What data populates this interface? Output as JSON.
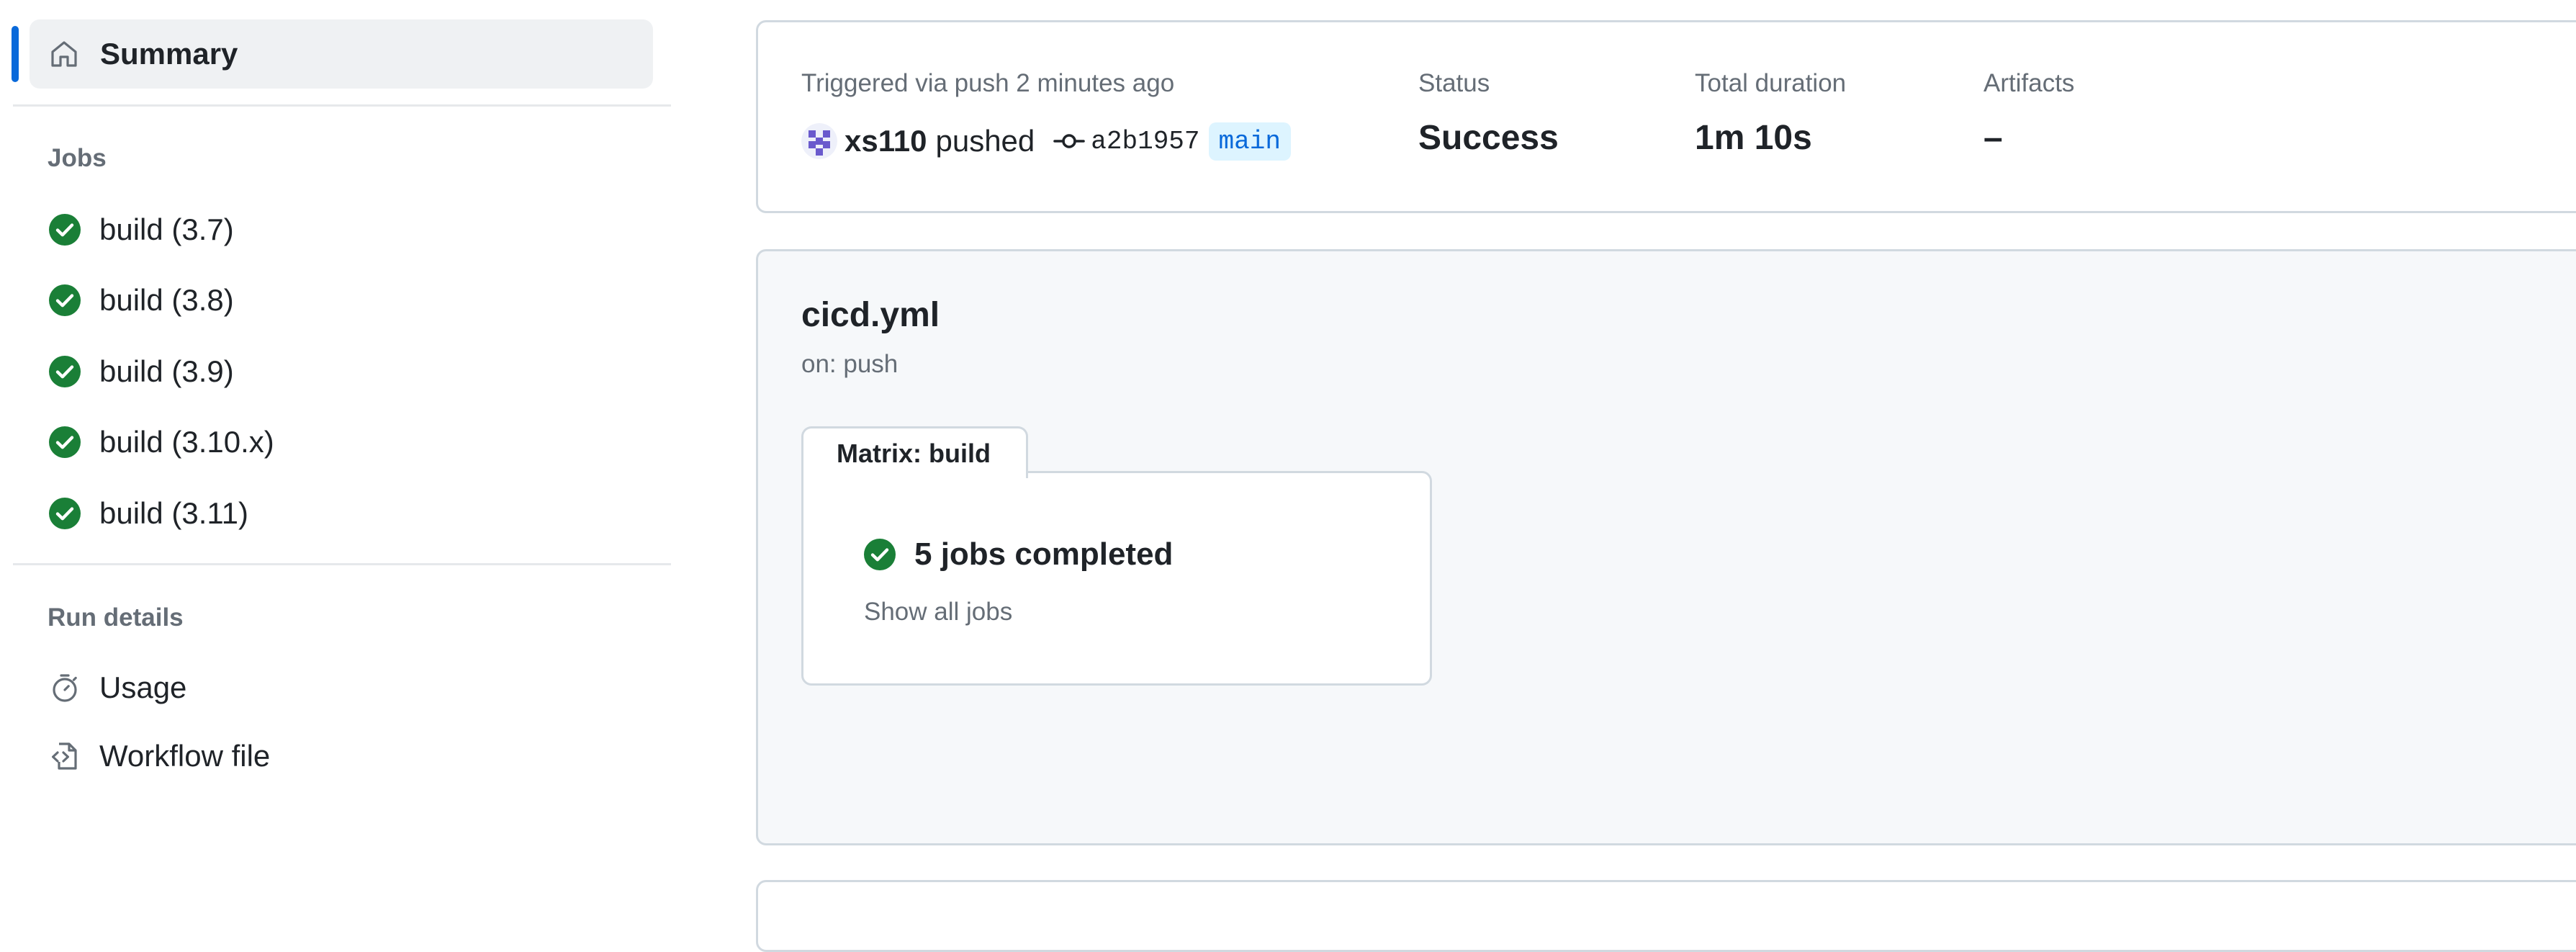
{
  "sidebar": {
    "summary_label": "Summary",
    "jobs_heading": "Jobs",
    "jobs": [
      {
        "label": "build (3.7)",
        "status": "success"
      },
      {
        "label": "build (3.8)",
        "status": "success"
      },
      {
        "label": "build (3.9)",
        "status": "success"
      },
      {
        "label": "build (3.10.x)",
        "status": "success"
      },
      {
        "label": "build (3.11)",
        "status": "success"
      }
    ],
    "run_details_heading": "Run details",
    "usage_label": "Usage",
    "workflow_file_label": "Workflow file"
  },
  "run": {
    "trigger_text": "Triggered via push 2 minutes ago",
    "actor": "xs110",
    "action": "pushed",
    "commit_sha": "a2b1957",
    "branch": "main",
    "status_label": "Status",
    "status_value": "Success",
    "duration_label": "Total duration",
    "duration_value": "1m 10s",
    "artifacts_label": "Artifacts",
    "artifacts_value": "–"
  },
  "workflow": {
    "file_name": "cicd.yml",
    "trigger": "on: push",
    "matrix_tab_label": "Matrix: build",
    "matrix_status_text": "5 jobs completed",
    "show_all_label": "Show all jobs"
  },
  "colors": {
    "success": "#1a7f37",
    "accent": "#0969da",
    "muted": "#656d76",
    "border": "#d1d9e0"
  }
}
